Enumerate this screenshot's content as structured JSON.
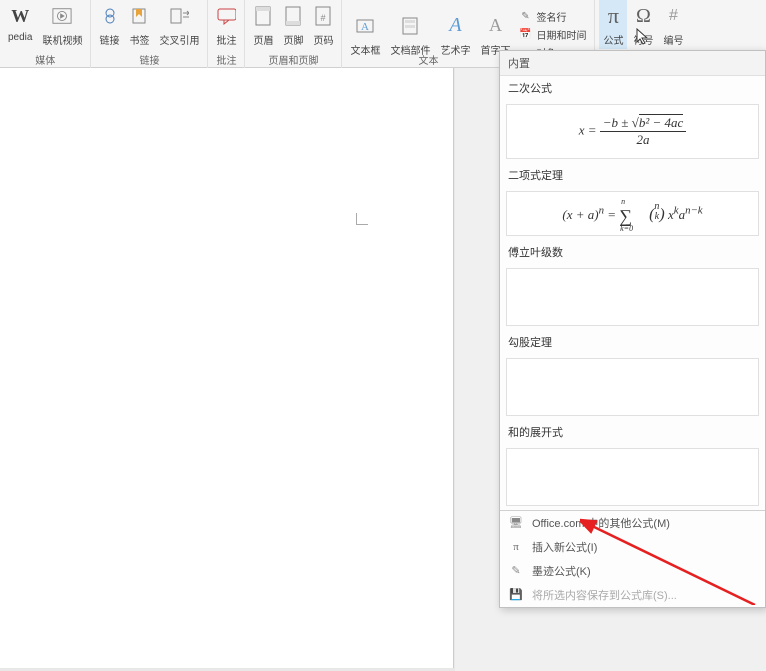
{
  "ribbon": {
    "groups": {
      "media": {
        "label": "媒体",
        "items": [
          {
            "label": "pedia",
            "icon": "W"
          },
          {
            "label": "联机视频",
            "icon": "▶"
          }
        ]
      },
      "links": {
        "label": "链接",
        "items": [
          {
            "label": "链接",
            "icon": "🔗"
          },
          {
            "label": "书签",
            "icon": "▸"
          },
          {
            "label": "交叉引用",
            "icon": "⇄"
          }
        ]
      },
      "comments": {
        "label": "批注",
        "items": [
          {
            "label": "批注",
            "icon": "💬"
          }
        ]
      },
      "header_footer": {
        "label": "页眉和页脚",
        "items": [
          {
            "label": "页眉",
            "icon": "📄"
          },
          {
            "label": "页脚",
            "icon": "📄"
          },
          {
            "label": "页码",
            "icon": "#"
          }
        ]
      },
      "text": {
        "label": "文本",
        "items": [
          {
            "label": "文本框",
            "icon": "A"
          },
          {
            "label": "文档部件",
            "icon": "📋"
          },
          {
            "label": "艺术字",
            "icon": "A"
          },
          {
            "label": "首字下",
            "icon": "A"
          }
        ],
        "small_items": [
          {
            "label": "签名行",
            "icon": "✎"
          },
          {
            "label": "日期和时间",
            "icon": "📅"
          },
          {
            "label": "对象",
            "icon": "□"
          }
        ]
      },
      "symbols": {
        "items": [
          {
            "label": "公式",
            "icon": "π"
          },
          {
            "label": "符号",
            "icon": "Ω"
          },
          {
            "label": "编号",
            "icon": "#"
          }
        ]
      }
    }
  },
  "dropdown": {
    "header": "内置",
    "sections": [
      {
        "title": "二次公式",
        "has_formula": true
      },
      {
        "title": "二项式定理",
        "has_formula": true
      },
      {
        "title": "傅立叶级数",
        "has_formula": false
      },
      {
        "title": "勾股定理",
        "has_formula": false
      },
      {
        "title": "和的展开式",
        "has_formula": false
      }
    ],
    "menu_items": [
      {
        "icon": "🌐",
        "label": "Office.com 中的其他公式(M)",
        "disabled": false
      },
      {
        "icon": "π",
        "label": "插入新公式(I)",
        "disabled": false
      },
      {
        "icon": "✎",
        "label": "墨迹公式(K)",
        "disabled": false
      },
      {
        "icon": "💾",
        "label": "将所选内容保存到公式库(S)...",
        "disabled": true
      }
    ]
  }
}
